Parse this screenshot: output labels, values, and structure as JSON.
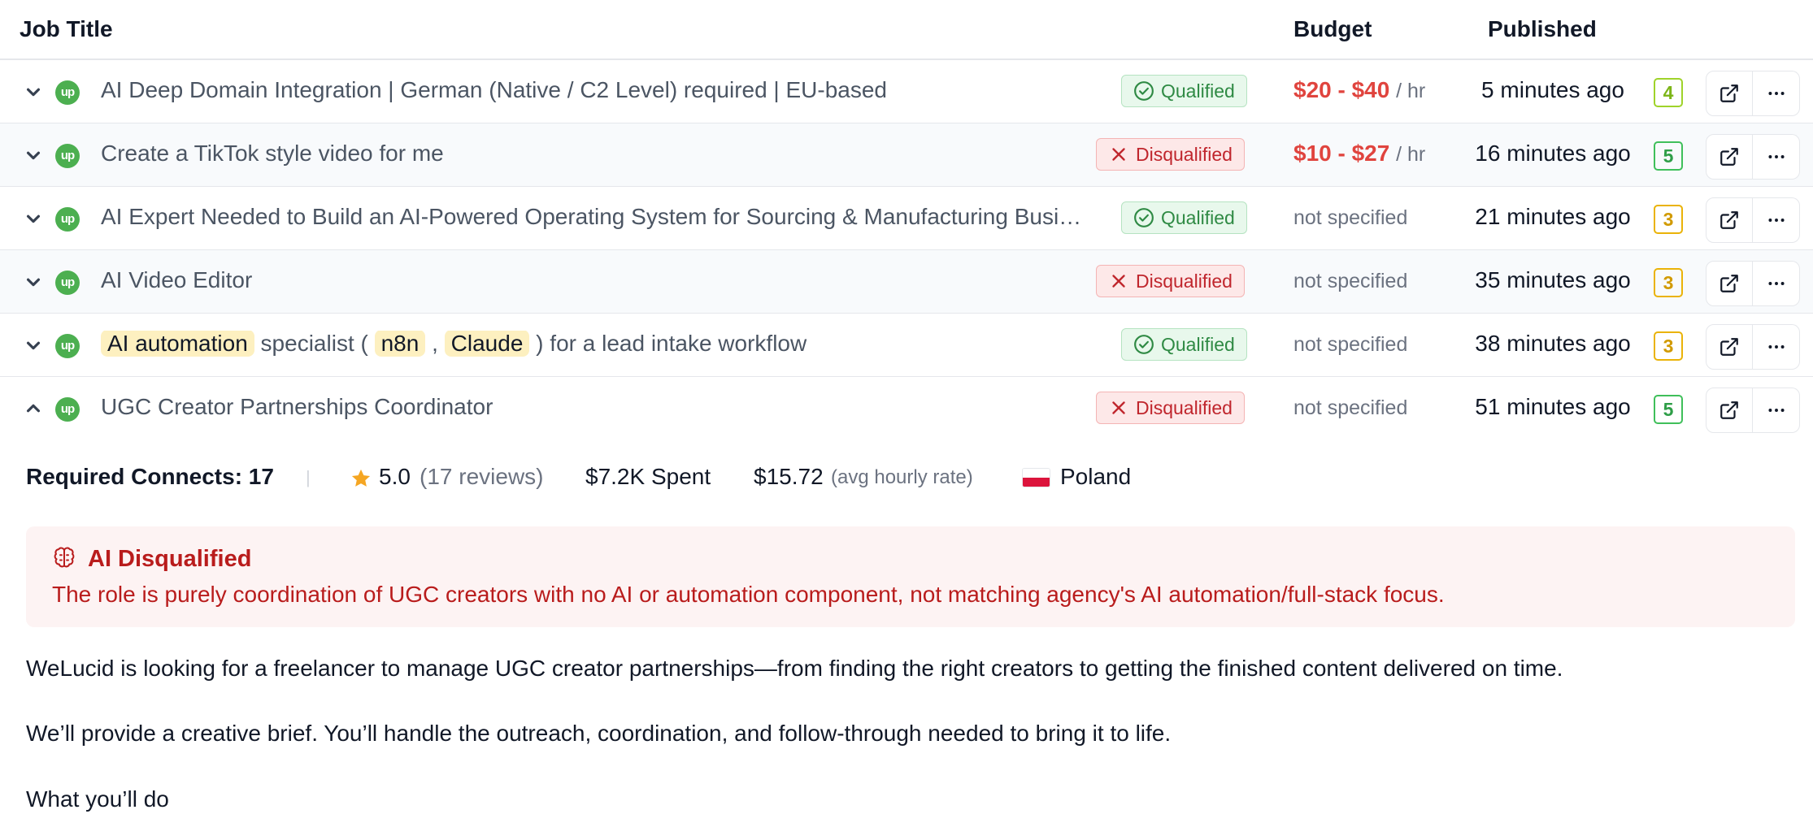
{
  "header": {
    "job_title": "Job Title",
    "budget": "Budget",
    "published": "Published"
  },
  "rows": [
    {
      "title": "AI Deep Domain Integration | German (Native / C2 Level) required | EU-based",
      "status": "Qualified",
      "budget_amount": "$20 - $40",
      "budget_unit": "/ hr",
      "published": "5 minutes ago",
      "score": "4",
      "score_color": "#7cb518"
    },
    {
      "title": "Create a TikTok style video for me",
      "status": "Disqualified",
      "budget_amount": "$10 - $27",
      "budget_unit": "/ hr",
      "published": "16 minutes ago",
      "score": "5",
      "score_color": "#2f9e48"
    },
    {
      "title": "AI Expert Needed to Build an AI-Powered Operating System for Sourcing & Manufacturing Busi…",
      "status": "Qualified",
      "budget_text": "not specified",
      "published": "21 minutes ago",
      "score": "3",
      "score_color": "#d19a00"
    },
    {
      "title": "AI Video Editor",
      "status": "Disqualified",
      "budget_text": "not specified",
      "published": "35 minutes ago",
      "score": "3",
      "score_color": "#d19a00"
    },
    {
      "title_parts": [
        "AI automation",
        " specialist ( ",
        "n8n",
        " , ",
        "Claude",
        " ) for a lead intake workflow"
      ],
      "status": "Qualified",
      "budget_text": "not specified",
      "published": "38 minutes ago",
      "score": "3",
      "score_color": "#d19a00"
    },
    {
      "title": "UGC Creator Partnerships Coordinator",
      "status": "Disqualified",
      "budget_text": "not specified",
      "published": "51 minutes ago",
      "score": "5",
      "score_color": "#2f9e48",
      "expanded": true
    }
  ],
  "details": {
    "connects_label": "Required Connects: 17",
    "separator": "|",
    "rating": "5.0",
    "reviews": "(17 reviews)",
    "spent": "$7.2K Spent",
    "rate": "$15.72",
    "rate_label": "(avg hourly rate)",
    "country": "Poland",
    "ai_title": "AI Disqualified",
    "ai_reason": "The role is purely coordination of UGC creators with no AI or automation component, not matching agency's AI automation/full-stack focus.",
    "description": [
      "WeLucid is looking for a freelancer to manage UGC creator partnerships—from finding the right creators to getting the finished content delivered on time.",
      "We’ll provide a creative brief. You’ll handle the outreach, coordination, and follow-through needed to bring it to life.",
      "What you’ll do"
    ]
  },
  "icons": {
    "row_toggle": "chevron-down-icon",
    "row_toggle_open": "chevron-up-icon",
    "source": "upwork-logo",
    "qualified": "check-circle-icon",
    "disqualified": "x-icon",
    "open_external": "external-link-icon",
    "more": "more-horizontal-icon",
    "rating": "star-icon",
    "ai": "brain-icon",
    "flag": "poland-flag-icon"
  },
  "colors": {
    "qualified": "#2f8a44",
    "disqualified": "#c0262d",
    "budget": "#e0443e",
    "alert": "#b91c1c"
  }
}
